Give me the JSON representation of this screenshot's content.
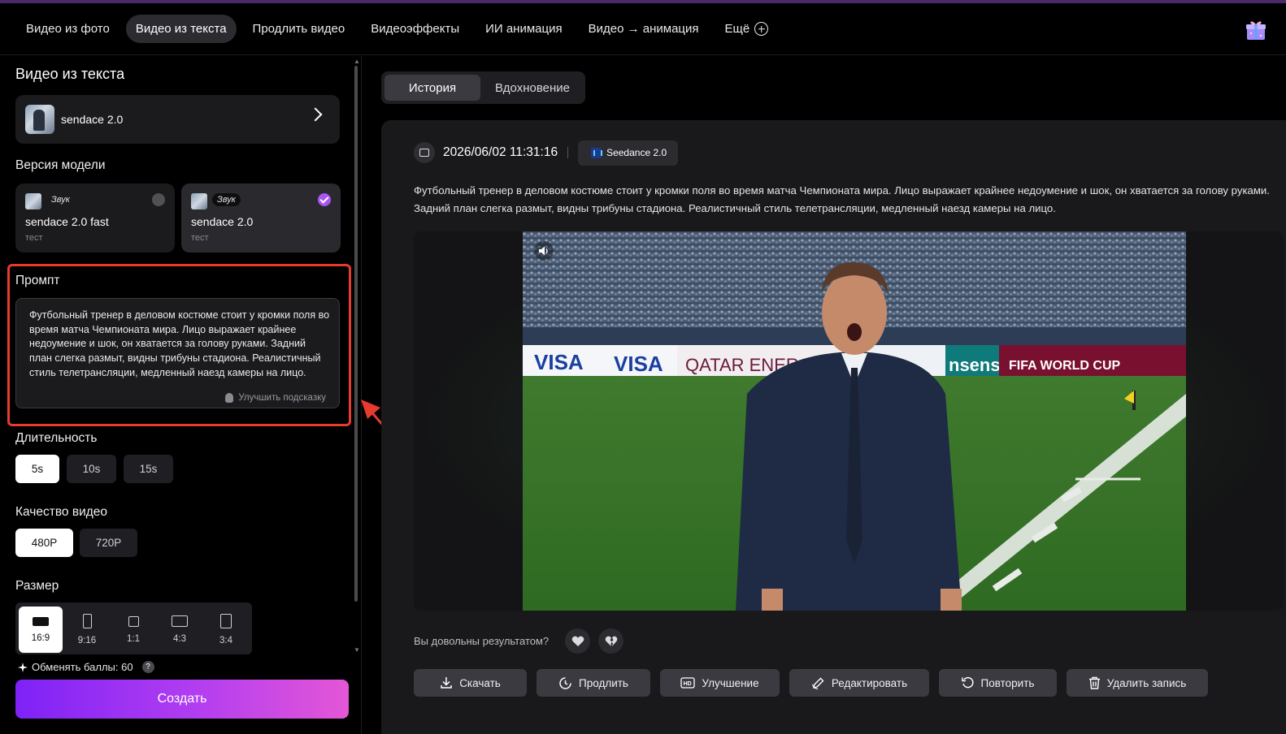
{
  "nav": {
    "items": [
      "Видео из фото",
      "Видео из текста",
      "Продлить видео",
      "Видеоэффекты",
      "ИИ анимация",
      "Видео → анимация"
    ],
    "active_index": 1,
    "more_label": "Ещё"
  },
  "left": {
    "title": "Видео из текста",
    "model_name": "sendace 2.0",
    "version_label": "Версия модели",
    "versions": [
      {
        "tag": "Звук",
        "name": "sendace 2.0 fast",
        "sub": "тест",
        "selected": false
      },
      {
        "tag": "Звук",
        "name": "sendace 2.0",
        "sub": "тест",
        "selected": true
      }
    ],
    "prompt_label": "Промпт",
    "prompt_text": "Футбольный тренер в деловом костюме стоит у кромки поля во время матча Чемпионата мира. Лицо выражает крайнее недоумение и шок, он хватается за голову руками. Задний план слегка размыт, видны трибуны стадиона. Реалистичный стиль телетрансляции, медленный наезд камеры на лицо.",
    "improve_label": "Улучшить подсказку",
    "duration_label": "Длительность",
    "durations": [
      "5s",
      "10s",
      "15s"
    ],
    "duration_selected": "5s",
    "quality_label": "Качество видео",
    "qualities": [
      "480P",
      "720P"
    ],
    "quality_selected": "480P",
    "size_label": "Размер",
    "sizes": [
      "16:9",
      "9:16",
      "1:1",
      "4:3",
      "3:4"
    ],
    "size_selected": "16:9",
    "points_label": "Обменять баллы: 60",
    "points_help": "?",
    "create_label": "Создать",
    "highlight_color": "#e63b2e",
    "accent_gradient": [
      "#7e22f6",
      "#e457d6"
    ]
  },
  "right": {
    "tabs": [
      "История",
      "Вдохновение"
    ],
    "active_tab": "История",
    "timestamp": "2026/06/02 11:31:16",
    "model_chip": "Seedance 2.0",
    "description": "Футбольный тренер в деловом костюме стоит у кромки поля во время матча Чемпионата мира. Лицо выражает крайнее недоумение и шок, он хватается за голову руками. Задний план слегка размыт, видны трибуны стадиона. Реалистичный стиль телетрансляции, медленный наезд камеры на лицо.",
    "board_texts": [
      "VISA",
      "VISA",
      "QATAR ENERGY",
      "nsense",
      "FIFA WORLD CUP"
    ],
    "feedback_question": "Вы довольны результатом?",
    "actions": [
      "Скачать",
      "Продлить",
      "Улучшение",
      "Редактировать",
      "Повторить",
      "Удалить запись"
    ]
  }
}
